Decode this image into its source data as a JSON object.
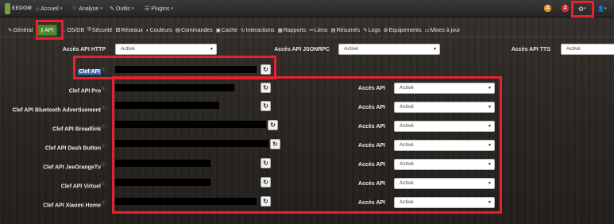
{
  "navbar": {
    "logo_text": "EEDOM",
    "menus": [
      {
        "icon": "home-icon",
        "glyph": "⌂",
        "label": "Accueil"
      },
      {
        "icon": "stethoscope-icon",
        "glyph": "♡",
        "label": "Analyse"
      },
      {
        "icon": "wrench-icon",
        "glyph": "✎",
        "label": "Outils"
      },
      {
        "icon": "tasks-icon",
        "glyph": "☰",
        "label": "Plugins"
      }
    ],
    "badges": [
      {
        "count": "2",
        "color": "#e8961e"
      },
      {
        "count": "2",
        "color": "#d9342b"
      }
    ]
  },
  "tabs": [
    {
      "glyph": "✎",
      "label": "Général"
    },
    {
      "glyph": "⚷",
      "label": "API"
    },
    {
      "glyph": "",
      "label": "... OS/DB"
    },
    {
      "glyph": "⛨",
      "label": "Sécurité"
    },
    {
      "glyph": "⚅",
      "label": "Réseaux"
    },
    {
      "glyph": "◐",
      "label": "Couleurs"
    },
    {
      "glyph": "▤",
      "label": "Commandes"
    },
    {
      "glyph": "▣",
      "label": "Cache"
    },
    {
      "glyph": "↻",
      "label": "Interactions"
    },
    {
      "glyph": "▦",
      "label": "Rapports"
    },
    {
      "glyph": "⚯",
      "label": "Liens"
    },
    {
      "glyph": "▤",
      "label": "Résumés"
    },
    {
      "glyph": "✎",
      "label": "Logs"
    },
    {
      "glyph": "⚙",
      "label": "Equipements"
    },
    {
      "glyph": "▭",
      "label": "Mises à jour"
    }
  ],
  "api_access": {
    "http_label": "Accès API HTTP",
    "http_value": "Activé",
    "jsonrpc_label": "Accès API JSONRPC",
    "jsonrpc_value": "Activé",
    "tts_label": "Accès API TTS",
    "tts_value": "Activé"
  },
  "keys": [
    {
      "label": "Clef API",
      "has_access": false
    },
    {
      "label": "Clef API Pro",
      "access_label": "Accès API",
      "access_value": "Activé"
    },
    {
      "label": "Clef API Bluetooth Advertisement",
      "access_label": "Accès API",
      "access_value": "Activé"
    },
    {
      "label": "Clef API Broadlink",
      "access_label": "Accès API",
      "access_value": "Activé"
    },
    {
      "label": "Clef API Dash Button",
      "access_label": "Accès API",
      "access_value": "Activé"
    },
    {
      "label": "Clef API JeeOrangeTv",
      "access_label": "Accès API",
      "access_value": "Activé"
    },
    {
      "label": "Clef API Virtuel",
      "access_label": "Accès API",
      "access_value": "Activé"
    },
    {
      "label": "Clef API Xiaomi Home",
      "access_label": "Accès API",
      "access_value": "Activé"
    }
  ],
  "info_glyph": "ⓘ",
  "refresh_glyph": "↻",
  "select_arrow": "▼",
  "gear_glyph": "⚙",
  "user_glyph": "👤",
  "caret_glyph": "▾"
}
